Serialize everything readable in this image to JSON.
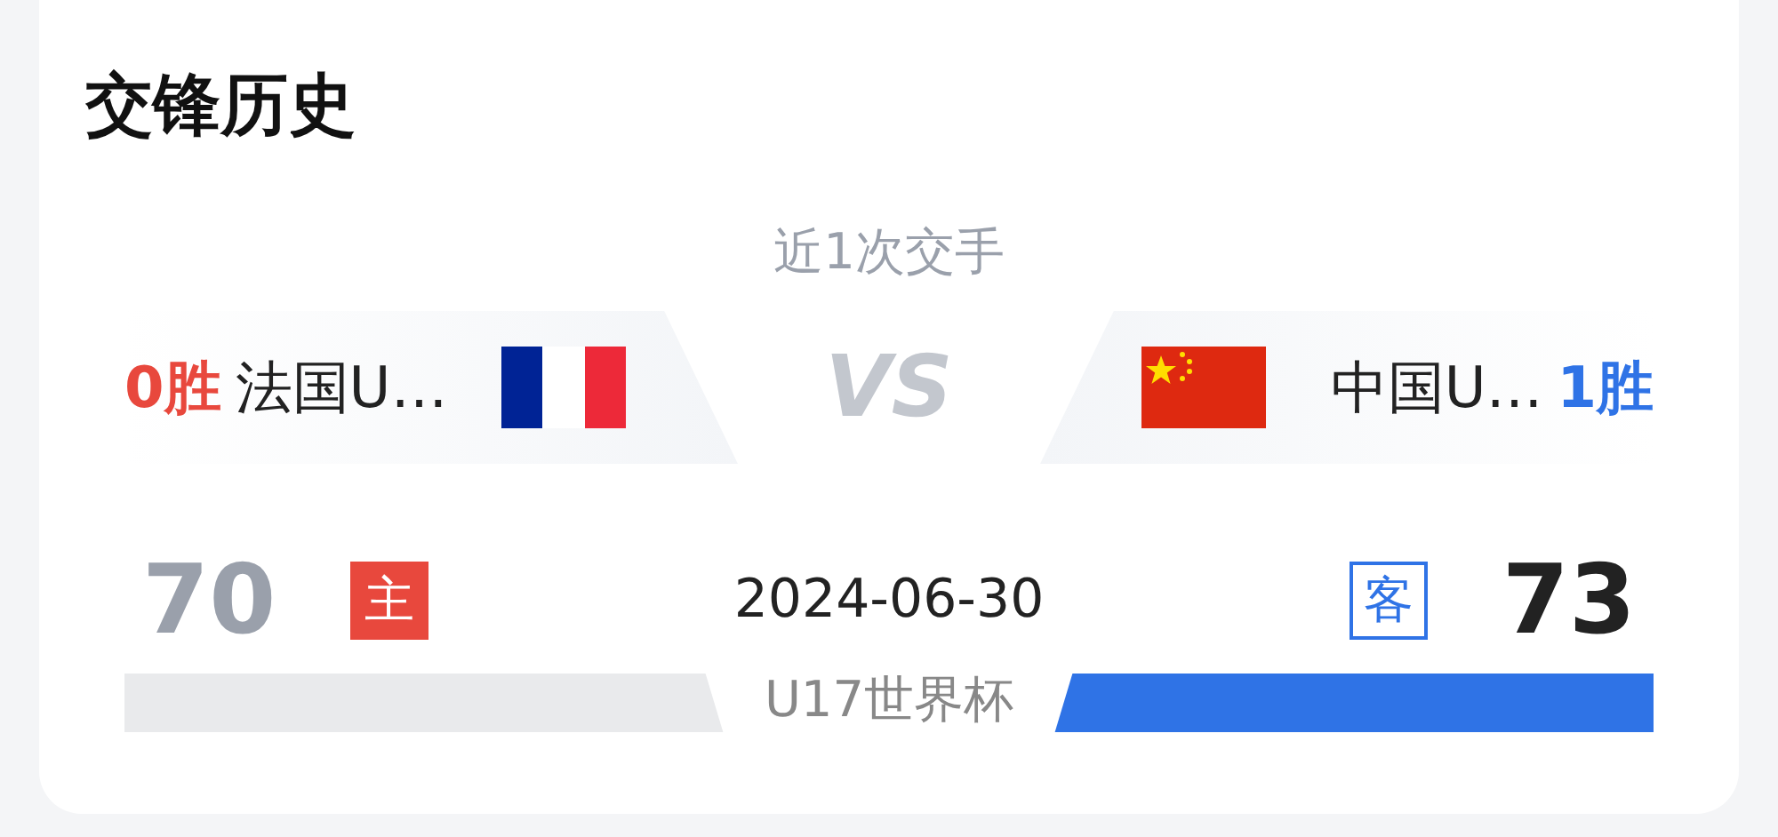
{
  "section_title": "交锋历史",
  "summary": "近1次交手",
  "vs_label": "VS",
  "teams": [
    {
      "kind": "home",
      "wins": "0胜",
      "name": "法国U…",
      "flag": {
        "kind": "france"
      },
      "score": "70",
      "badge": "主",
      "won": false
    },
    {
      "kind": "away",
      "wins": "1胜",
      "name": "中国U…",
      "flag": {
        "kind": "china"
      },
      "score": "73",
      "badge": "客",
      "won": true
    }
  ],
  "match": {
    "date": "2024-06-30",
    "competition": "U17世界杯"
  }
}
